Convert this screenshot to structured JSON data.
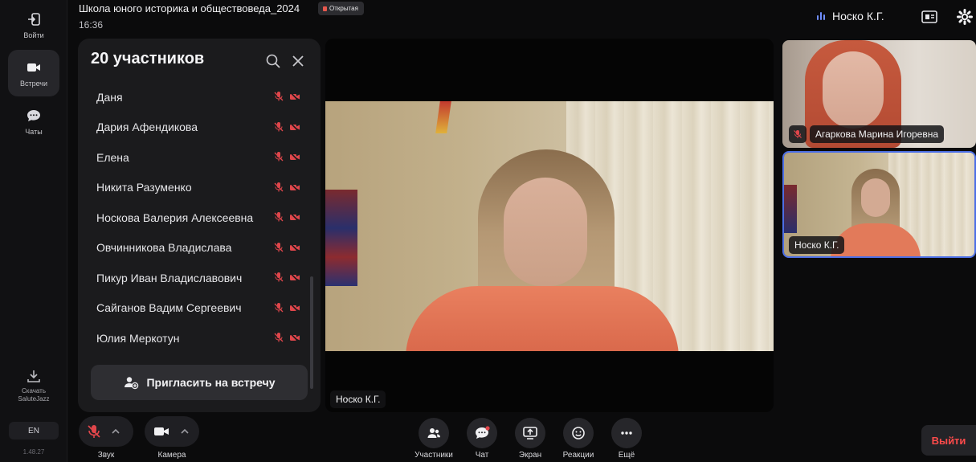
{
  "rail": {
    "items": [
      {
        "label": "Войти",
        "icon": "login-icon"
      },
      {
        "label": "Встречи",
        "icon": "video-camera-icon",
        "active": true
      },
      {
        "label": "Чаты",
        "icon": "chat-bubble-icon"
      }
    ],
    "download_label_1": "Скачать",
    "download_label_2": "SaluteJazz",
    "language": "EN",
    "version": "1.48.27"
  },
  "header": {
    "meeting_title": "Школа юного историка и обществоведа_2024",
    "status_badge": "Открытая",
    "time": "16:36",
    "active_speaker": "Носко К.Г."
  },
  "participants_panel": {
    "title": "20 участников",
    "participants": [
      "Даня",
      "Дария Афендикова",
      "Елена",
      "Никита Разуменко",
      "Носкова Валерия Алексеевна",
      "Овчинникова Владислава",
      "Пикур Иван Владиславович",
      "Сайганов Вадим Сергеевич",
      "Юлия Меркотун"
    ],
    "invite_label": "Пригласить на встречу"
  },
  "main_video": {
    "name": "Носко К.Г."
  },
  "tiles": [
    {
      "name": "Агаркова Марина Игоревна",
      "muted": true
    },
    {
      "name": "Носко К.Г.",
      "muted": false
    }
  ],
  "toolbar": {
    "mic_label": "Звук",
    "camera_label": "Камера",
    "participants_label": "Участники",
    "chat_label": "Чат",
    "screen_label": "Экран",
    "reactions_label": "Реакции",
    "more_label": "Ещё",
    "leave_label": "Выйти"
  },
  "colors": {
    "accent": "#4c6fe6",
    "danger": "#ff4b4b",
    "muted_icon": "#e0464b"
  }
}
